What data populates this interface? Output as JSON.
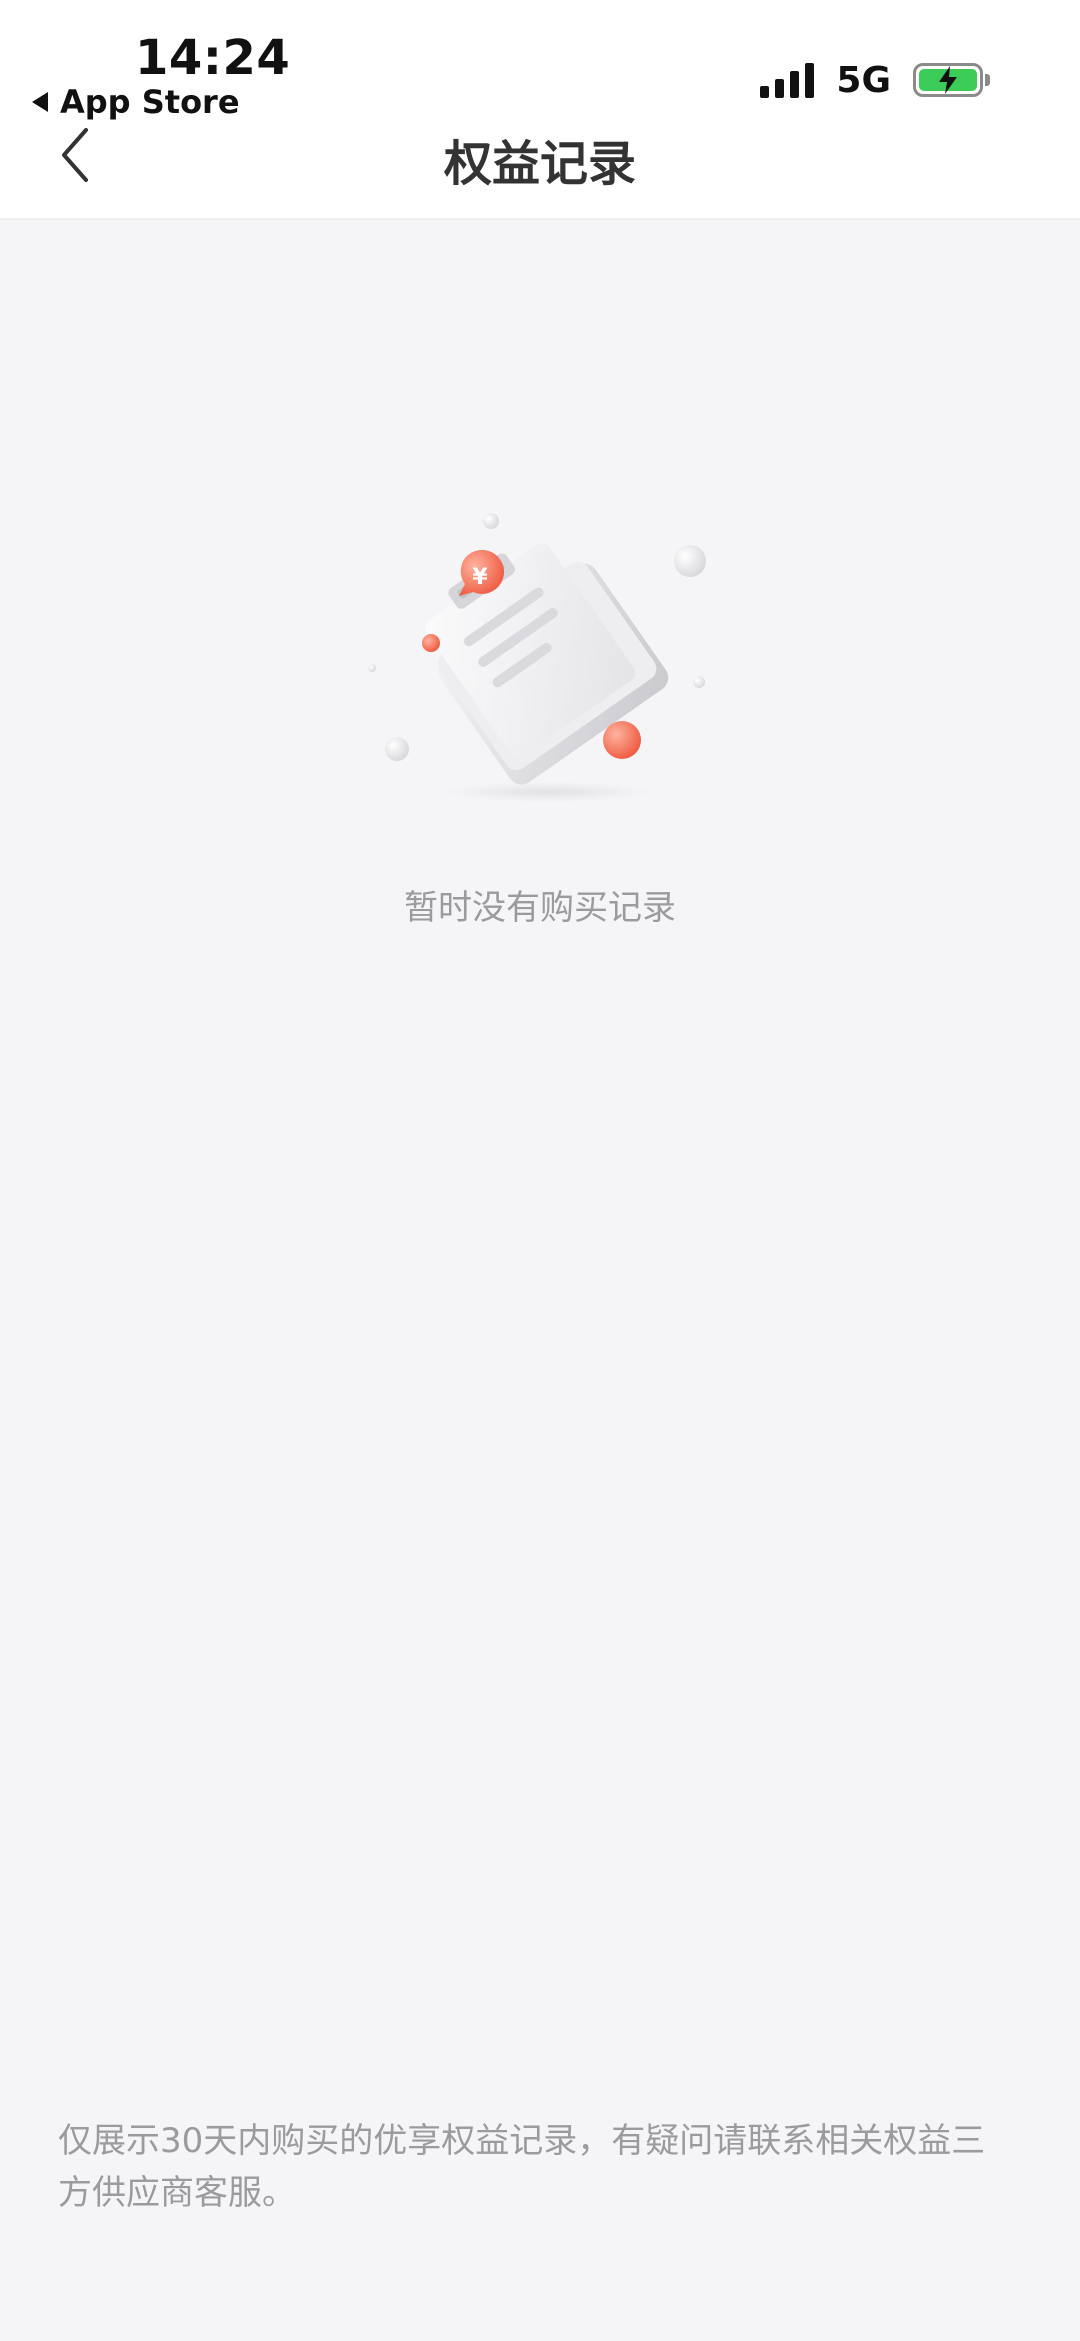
{
  "status_bar": {
    "time": "14:24",
    "back_app": "App Store",
    "network": "5G"
  },
  "nav": {
    "title": "权益记录"
  },
  "empty_state": {
    "message": "暂时没有购买记录"
  },
  "footer": {
    "notice": "仅展示30天内购买的优享权益记录，有疑问请联系相关权益三方供应商客服。"
  },
  "colors": {
    "accent": "#f07a5d",
    "background": "#f5f5f7",
    "battery": "#3ccd59"
  }
}
